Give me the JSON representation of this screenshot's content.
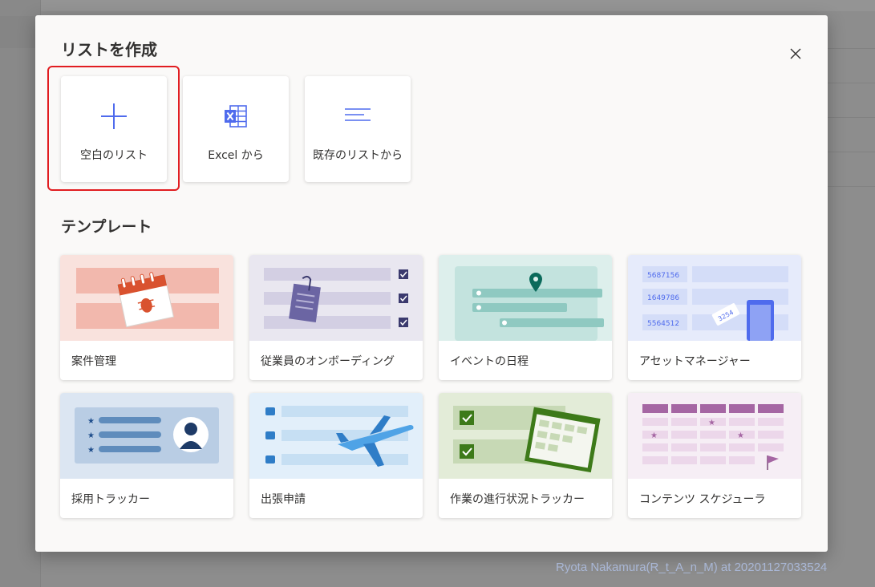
{
  "dialog": {
    "title": "リストを作成",
    "close_label": "×"
  },
  "create_options": [
    {
      "label": "空白のリスト",
      "icon": "plus-icon"
    },
    {
      "label": "Excel から",
      "icon": "excel-icon"
    },
    {
      "label": "既存のリストから",
      "icon": "list-lines-icon"
    }
  ],
  "templates_section": {
    "title": "テンプレート",
    "items": [
      {
        "label": "案件管理",
        "thumb_color": "#f9e2dd"
      },
      {
        "label": "従業員のオンボーディング",
        "thumb_color": "#e9e7f0"
      },
      {
        "label": "イベントの日程",
        "thumb_color": "#ddefec"
      },
      {
        "label": "アセットマネージャー",
        "thumb_color": "#e6ebfb"
      },
      {
        "label": "採用トラッカー",
        "thumb_color": "#dce6f2"
      },
      {
        "label": "出張申請",
        "thumb_color": "#e2effa"
      },
      {
        "label": "作業の進行状況トラッカー",
        "thumb_color": "#e3ecd8"
      },
      {
        "label": "コンテンツ スケジューラ",
        "thumb_color": "#f6eef5"
      }
    ]
  },
  "asset_numbers": [
    "5687156",
    "1649786",
    "5564512",
    "3254"
  ],
  "watermark": "Ryota Nakamura(R_t_A_n_M) at 20201127033524",
  "colors": {
    "accent": "#4f6bed",
    "highlight": "#e11d21"
  }
}
